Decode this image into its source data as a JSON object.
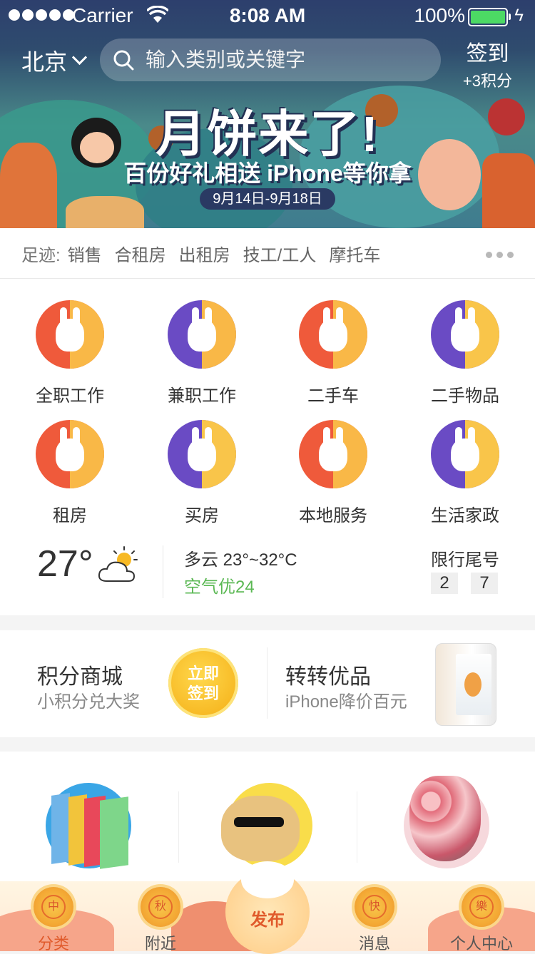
{
  "status_bar": {
    "carrier": "Carrier",
    "time": "8:08 AM",
    "battery": "100%"
  },
  "header": {
    "city": "北京",
    "search_placeholder": "输入类别或关键字",
    "signin_label": "签到",
    "signin_points": "+3积分"
  },
  "banner": {
    "title": "月饼来了!",
    "subtitle": "百份好礼相送 iPhone等你拿",
    "date": "9月14日-9月18日"
  },
  "footprints": {
    "label": "足迹:",
    "items": [
      "销售",
      "合租房",
      "出租房",
      "技工/工人",
      "摩托车"
    ]
  },
  "categories": [
    {
      "label": "全职工作",
      "icon": "rabbit-dancing-icon",
      "bg": "#ef5a3b",
      "accent": "#f9b847"
    },
    {
      "label": "兼职工作",
      "icon": "rabbit-carrot-icon",
      "bg": "#6a4bc4",
      "accent": "#f9b847"
    },
    {
      "label": "二手车",
      "icon": "rabbit-lying-icon",
      "bg": "#ef5a3b",
      "accent": "#f9b847"
    },
    {
      "label": "二手物品",
      "icon": "rabbit-sitting-icon",
      "bg": "#6a4bc4",
      "accent": "#f9c54a"
    },
    {
      "label": "租房",
      "icon": "rabbit-lantern-icon",
      "bg": "#ef5a3b",
      "accent": "#f9b847"
    },
    {
      "label": "买房",
      "icon": "rabbit-moon-icon",
      "bg": "#6a4bc4",
      "accent": "#f9c54a"
    },
    {
      "label": "本地服务",
      "icon": "rabbit-mortar-icon",
      "bg": "#ef5a3b",
      "accent": "#f9b847"
    },
    {
      "label": "生活家政",
      "icon": "rabbit-mooncake-icon",
      "bg": "#6a4bc4",
      "accent": "#f9c54a"
    }
  ],
  "weather": {
    "temperature": "27°",
    "condition": "多云 23°~32°C",
    "air_quality": "空气优24",
    "limit_label": "限行尾号",
    "limit_numbers": [
      "2",
      "7"
    ]
  },
  "mall": {
    "left_title": "积分商城",
    "left_sub": "小积分兑大奖",
    "coin_line1": "立即",
    "coin_line2": "签到",
    "right_title": "转转优品",
    "right_sub": "iPhone降价百元"
  },
  "tabs": {
    "items": [
      {
        "label": "分类",
        "icon_char": "中"
      },
      {
        "label": "附近",
        "icon_char": "秋"
      },
      {
        "label": "消息",
        "icon_char": "快"
      },
      {
        "label": "个人中心",
        "icon_char": "樂"
      }
    ],
    "publish_label": "发布"
  },
  "colors": {
    "accent": "#e05a2b",
    "green": "#5bb854",
    "gold": "#f7b924"
  }
}
